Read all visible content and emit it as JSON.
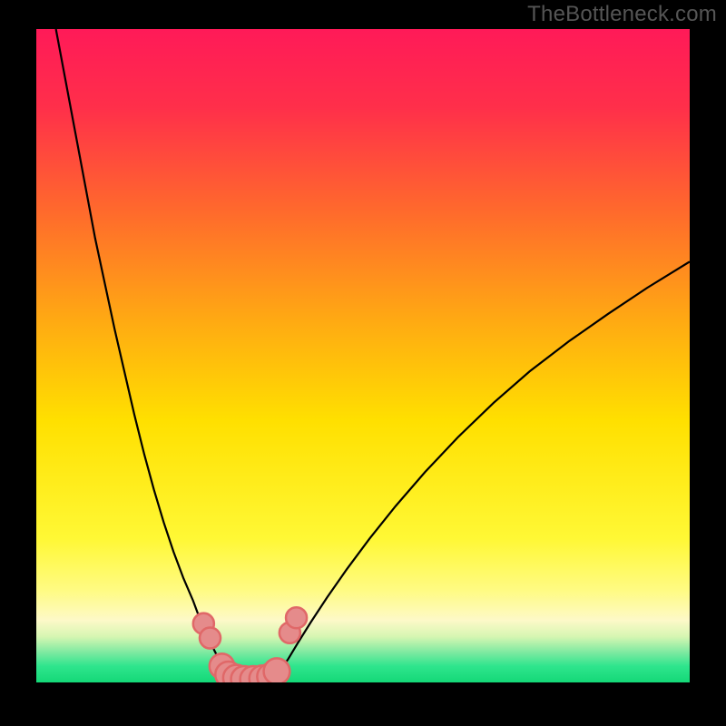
{
  "watermark": "TheBottleneck.com",
  "chart_data": {
    "type": "line",
    "title": "",
    "xlabel": "",
    "ylabel": "",
    "xlim": [
      0,
      100
    ],
    "ylim": [
      0,
      100
    ],
    "background_gradient_stops": [
      {
        "offset": 0.0,
        "color": "#ff1a58"
      },
      {
        "offset": 0.12,
        "color": "#ff2f4a"
      },
      {
        "offset": 0.28,
        "color": "#ff6a2c"
      },
      {
        "offset": 0.45,
        "color": "#ffab12"
      },
      {
        "offset": 0.6,
        "color": "#ffe000"
      },
      {
        "offset": 0.78,
        "color": "#fff835"
      },
      {
        "offset": 0.86,
        "color": "#fffb84"
      },
      {
        "offset": 0.905,
        "color": "#fdf9c8"
      },
      {
        "offset": 0.93,
        "color": "#d6f6b2"
      },
      {
        "offset": 0.955,
        "color": "#7ae9a0"
      },
      {
        "offset": 0.975,
        "color": "#2fe58d"
      },
      {
        "offset": 1.0,
        "color": "#14d877"
      }
    ],
    "series": [
      {
        "name": "left-curve",
        "x": [
          3.0,
          4.5,
          6.0,
          7.5,
          9.0,
          10.5,
          12.0,
          13.5,
          15.0,
          16.5,
          18.0,
          19.5,
          21.0,
          22.5,
          24.0,
          25.0,
          26.0,
          27.0,
          27.8,
          28.4,
          28.8,
          29.0
        ],
        "y": [
          100,
          92,
          84,
          76,
          68,
          61,
          54,
          47.5,
          41,
          35,
          29.5,
          24.5,
          20,
          16,
          12.5,
          9.8,
          7.4,
          5.4,
          3.8,
          2.4,
          1.2,
          0.0
        ]
      },
      {
        "name": "valley-floor",
        "x": [
          29.0,
          30.0,
          31.0,
          32.0,
          33.0,
          34.0,
          35.0,
          36.0
        ],
        "y": [
          0.0,
          0.0,
          0.0,
          0.0,
          0.0,
          0.0,
          0.0,
          0.0
        ]
      },
      {
        "name": "right-curve",
        "x": [
          36.0,
          37.0,
          38.5,
          40.0,
          42.0,
          44.5,
          47.5,
          51.0,
          55.0,
          59.5,
          64.5,
          70.0,
          75.5,
          81.5,
          87.5,
          93.5,
          100.0
        ],
        "y": [
          0.0,
          1.5,
          3.5,
          6.0,
          9.2,
          13.0,
          17.3,
          22.0,
          27.0,
          32.2,
          37.5,
          42.8,
          47.6,
          52.2,
          56.4,
          60.4,
          64.4
        ]
      }
    ],
    "markers": [
      {
        "x": 25.6,
        "y": 9.0,
        "r": 1.6
      },
      {
        "x": 26.6,
        "y": 6.8,
        "r": 1.6
      },
      {
        "x": 28.4,
        "y": 2.5,
        "r": 1.9
      },
      {
        "x": 29.4,
        "y": 1.2,
        "r": 2.0
      },
      {
        "x": 30.6,
        "y": 0.7,
        "r": 2.0
      },
      {
        "x": 31.8,
        "y": 0.5,
        "r": 2.0
      },
      {
        "x": 33.2,
        "y": 0.5,
        "r": 2.0
      },
      {
        "x": 34.6,
        "y": 0.6,
        "r": 2.0
      },
      {
        "x": 35.8,
        "y": 0.9,
        "r": 2.0
      },
      {
        "x": 36.8,
        "y": 1.7,
        "r": 2.0
      },
      {
        "x": 38.8,
        "y": 7.6,
        "r": 1.6
      },
      {
        "x": 39.8,
        "y": 9.9,
        "r": 1.6
      }
    ],
    "marker_stroke_color": "#e06868",
    "marker_fill_color": "#e58b8b",
    "curve_stroke_color": "#000000",
    "curve_stroke_width": 2.2
  }
}
